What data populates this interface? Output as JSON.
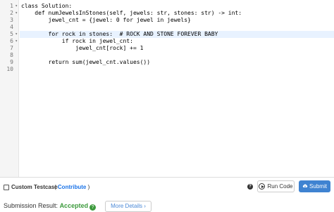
{
  "editor": {
    "lines": [
      {
        "n": "1",
        "fold": "▾",
        "code": "class Solution:"
      },
      {
        "n": "2",
        "fold": "▾",
        "code": "    def numJewelsInStones(self, jewels: str, stones: str) -> int:"
      },
      {
        "n": "3",
        "fold": "",
        "code": "        jewel_cnt = {jewel: 0 for jewel in jewels}"
      },
      {
        "n": "4",
        "fold": "",
        "code": ""
      },
      {
        "n": "5",
        "fold": "▾",
        "code": "        for rock in stones:  # ROCK AND STONE FOREVER BABY"
      },
      {
        "n": "6",
        "fold": "▾",
        "code": "            if rock in jewel_cnt:"
      },
      {
        "n": "7",
        "fold": "",
        "code": "                jewel_cnt[rock] += 1"
      },
      {
        "n": "8",
        "fold": "",
        "code": ""
      },
      {
        "n": "9",
        "fold": "",
        "code": "        return sum(jewel_cnt.values())"
      },
      {
        "n": "10",
        "fold": "",
        "code": ""
      }
    ]
  },
  "footer": {
    "custom_testcase": "Custom Testcase",
    "contribute_open": "(",
    "contribute": "Contribute",
    "contribute_close": ")",
    "help": "?",
    "run_code": "Run Code",
    "submit": "Submit"
  },
  "result": {
    "label": "Submission Result:",
    "status": "Accepted",
    "status_icon": "?",
    "more_details": "More Details ›",
    "status_color": "#3c9a3c"
  }
}
